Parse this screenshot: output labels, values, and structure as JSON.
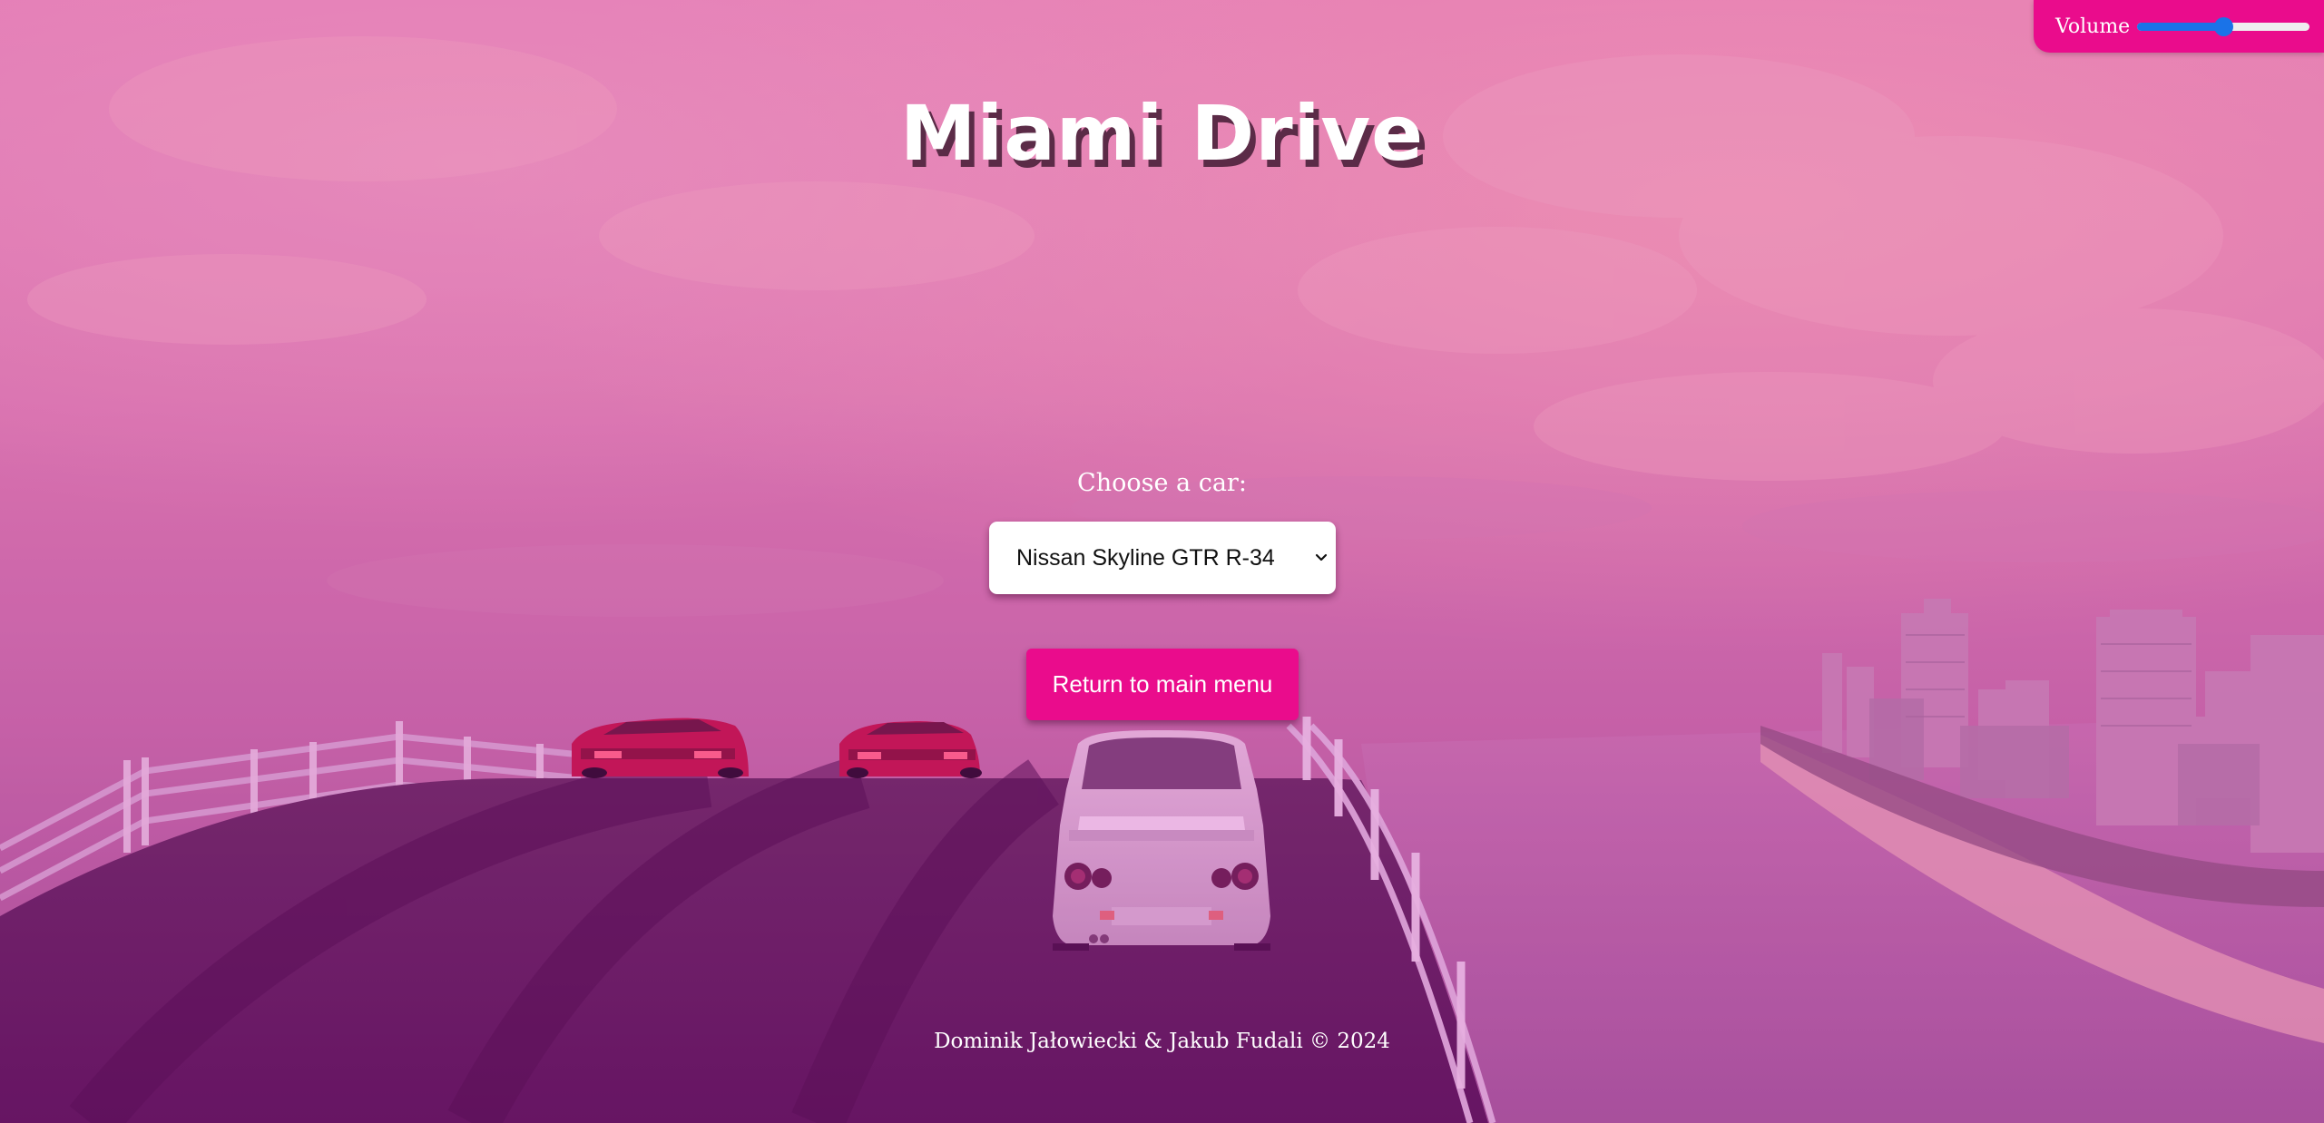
{
  "game": {
    "title": "Miami Drive"
  },
  "volume": {
    "label": "Volume",
    "level": 0.5
  },
  "car_select": {
    "label": "Choose a car:",
    "selected": "Nissan Skyline GTR R-34"
  },
  "menu": {
    "return_label": "Return to main menu"
  },
  "footer": {
    "credits": "Dominik Jałowiecki & Jakub Fudali © 2024"
  },
  "colors": {
    "accent": "#ea0c8c",
    "slider": "#1a73e8",
    "sky_top": "#e77bb4",
    "sky_bottom": "#b85aa6",
    "road": "#5f1361",
    "overlay": "#c43f9a"
  },
  "icons": {
    "select_arrow": "chevron-down-icon"
  }
}
